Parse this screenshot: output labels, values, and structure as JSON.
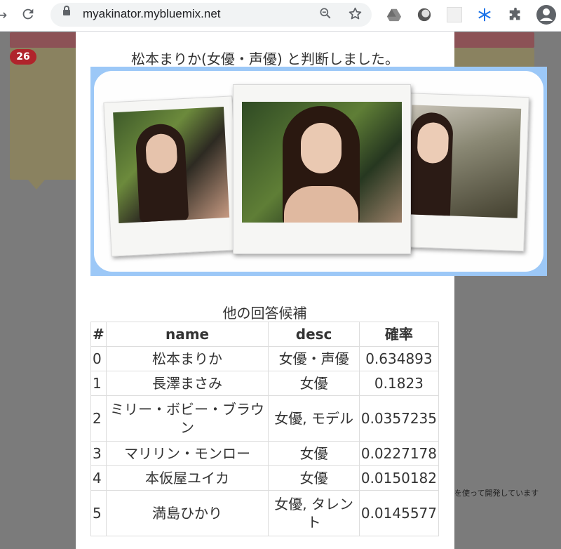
{
  "browser": {
    "url": "myakinator.mybluemix.net"
  },
  "background": {
    "badge_count": "26",
    "footnote": "を使って開発しています"
  },
  "result": {
    "headline": "松本まりか(女優・声優) と判断しました。"
  },
  "candidates": {
    "caption": "他の回答候補",
    "headers": [
      "#",
      "name",
      "desc",
      "確率"
    ],
    "rows": [
      {
        "idx": "0",
        "name": "松本まりか",
        "desc": "女優・声優",
        "prob": "0.634893"
      },
      {
        "idx": "1",
        "name": "長澤まさみ",
        "desc": "女優",
        "prob": "0.1823"
      },
      {
        "idx": "2",
        "name": "ミリー・ボビー・ブラウン",
        "desc": "女優, モデル",
        "prob": "0.0357235"
      },
      {
        "idx": "3",
        "name": "マリリン・モンロー",
        "desc": "女優",
        "prob": "0.0227178"
      },
      {
        "idx": "4",
        "name": "本仮屋ユイカ",
        "desc": "女優",
        "prob": "0.0150182"
      },
      {
        "idx": "5",
        "name": "満島ひかり",
        "desc": "女優, タレント",
        "prob": "0.0145577"
      }
    ]
  },
  "icons": [
    "back-icon",
    "reload-icon",
    "lock-icon",
    "zoom-icon",
    "star-icon",
    "drive-icon",
    "circle-ext-icon",
    "blank-ext-icon",
    "snowflake-ext-icon",
    "puzzle-icon",
    "profile-icon"
  ],
  "colors": {
    "overlay": "#7b7b7b",
    "badge": "#b0242b",
    "photo_frame": "#9cc8f7"
  }
}
